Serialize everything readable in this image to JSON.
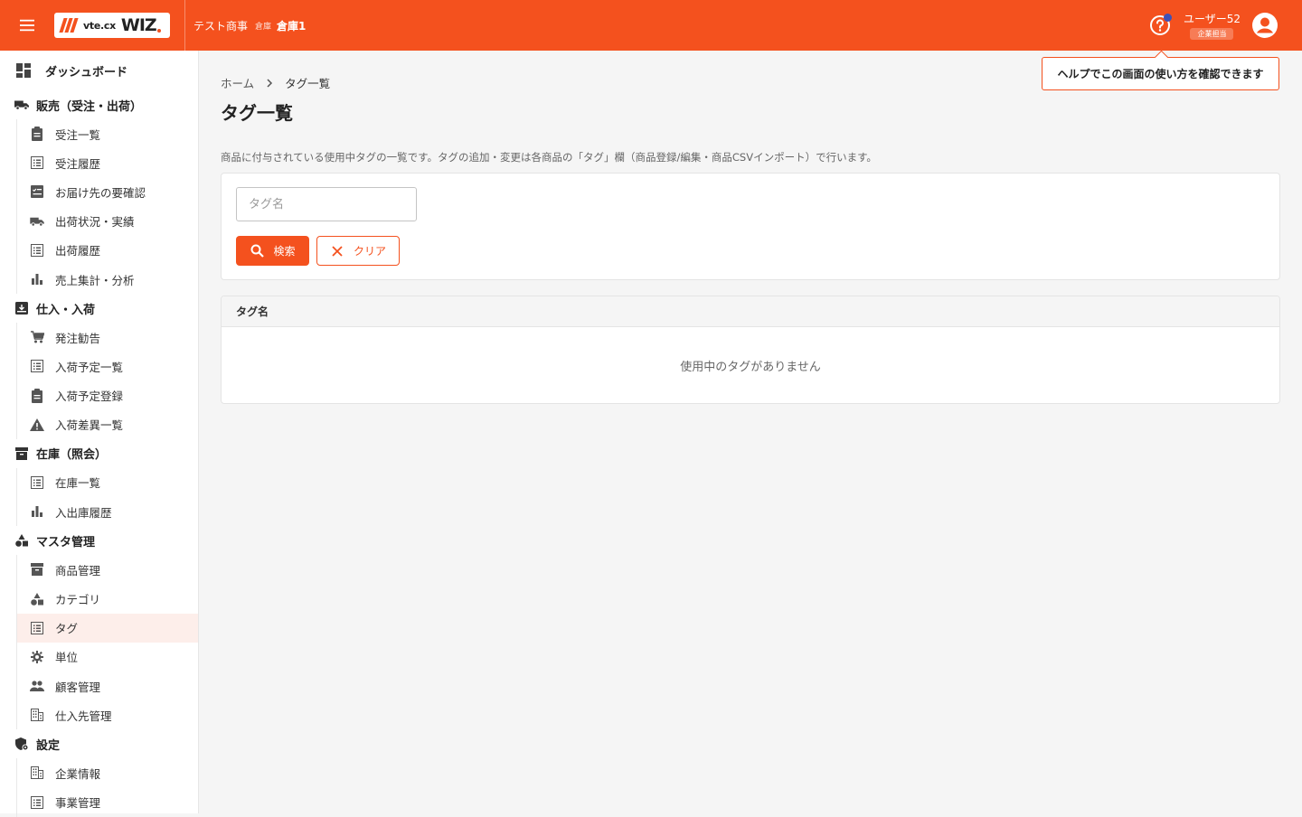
{
  "header": {
    "logo_small": "vte.cx",
    "logo_big": "WIZ",
    "company": "テスト商事",
    "warehouse_label": "倉庫",
    "warehouse_name": "倉庫1",
    "user_name": "ユーザー52",
    "user_role": "企業担当"
  },
  "tooltip": {
    "text": "ヘルプでこの画面の使い方を確認できます"
  },
  "sidebar": {
    "dashboard": "ダッシュボード",
    "sections": [
      {
        "label": "販売（受注・出荷）",
        "items": [
          "受注一覧",
          "受注履歴",
          "お届け先の要確認",
          "出荷状況・実績",
          "出荷履歴",
          "売上集計・分析"
        ]
      },
      {
        "label": "仕入・入荷",
        "items": [
          "発注勧告",
          "入荷予定一覧",
          "入荷予定登録",
          "入荷差異一覧"
        ]
      },
      {
        "label": "在庫（照会）",
        "items": [
          "在庫一覧",
          "入出庫履歴"
        ]
      },
      {
        "label": "マスタ管理",
        "items": [
          "商品管理",
          "カテゴリ",
          "タグ",
          "単位",
          "顧客管理",
          "仕入先管理"
        ]
      },
      {
        "label": "設定",
        "items": [
          "企業情報",
          "事業管理"
        ]
      }
    ]
  },
  "breadcrumb": {
    "home": "ホーム",
    "current": "タグ一覧"
  },
  "page": {
    "title": "タグ一覧",
    "description": "商品に付与されている使用中タグの一覧です。タグの追加・変更は各商品の「タグ」欄（商品登録/編集・商品CSVインポート）で行います。"
  },
  "search": {
    "placeholder": "タグ名",
    "search_label": "検索",
    "clear_label": "クリア"
  },
  "table": {
    "column": "タグ名",
    "empty_message": "使用中のタグがありません"
  },
  "colors": {
    "accent": "#f4511e",
    "active_bg": "#fdeeea"
  }
}
